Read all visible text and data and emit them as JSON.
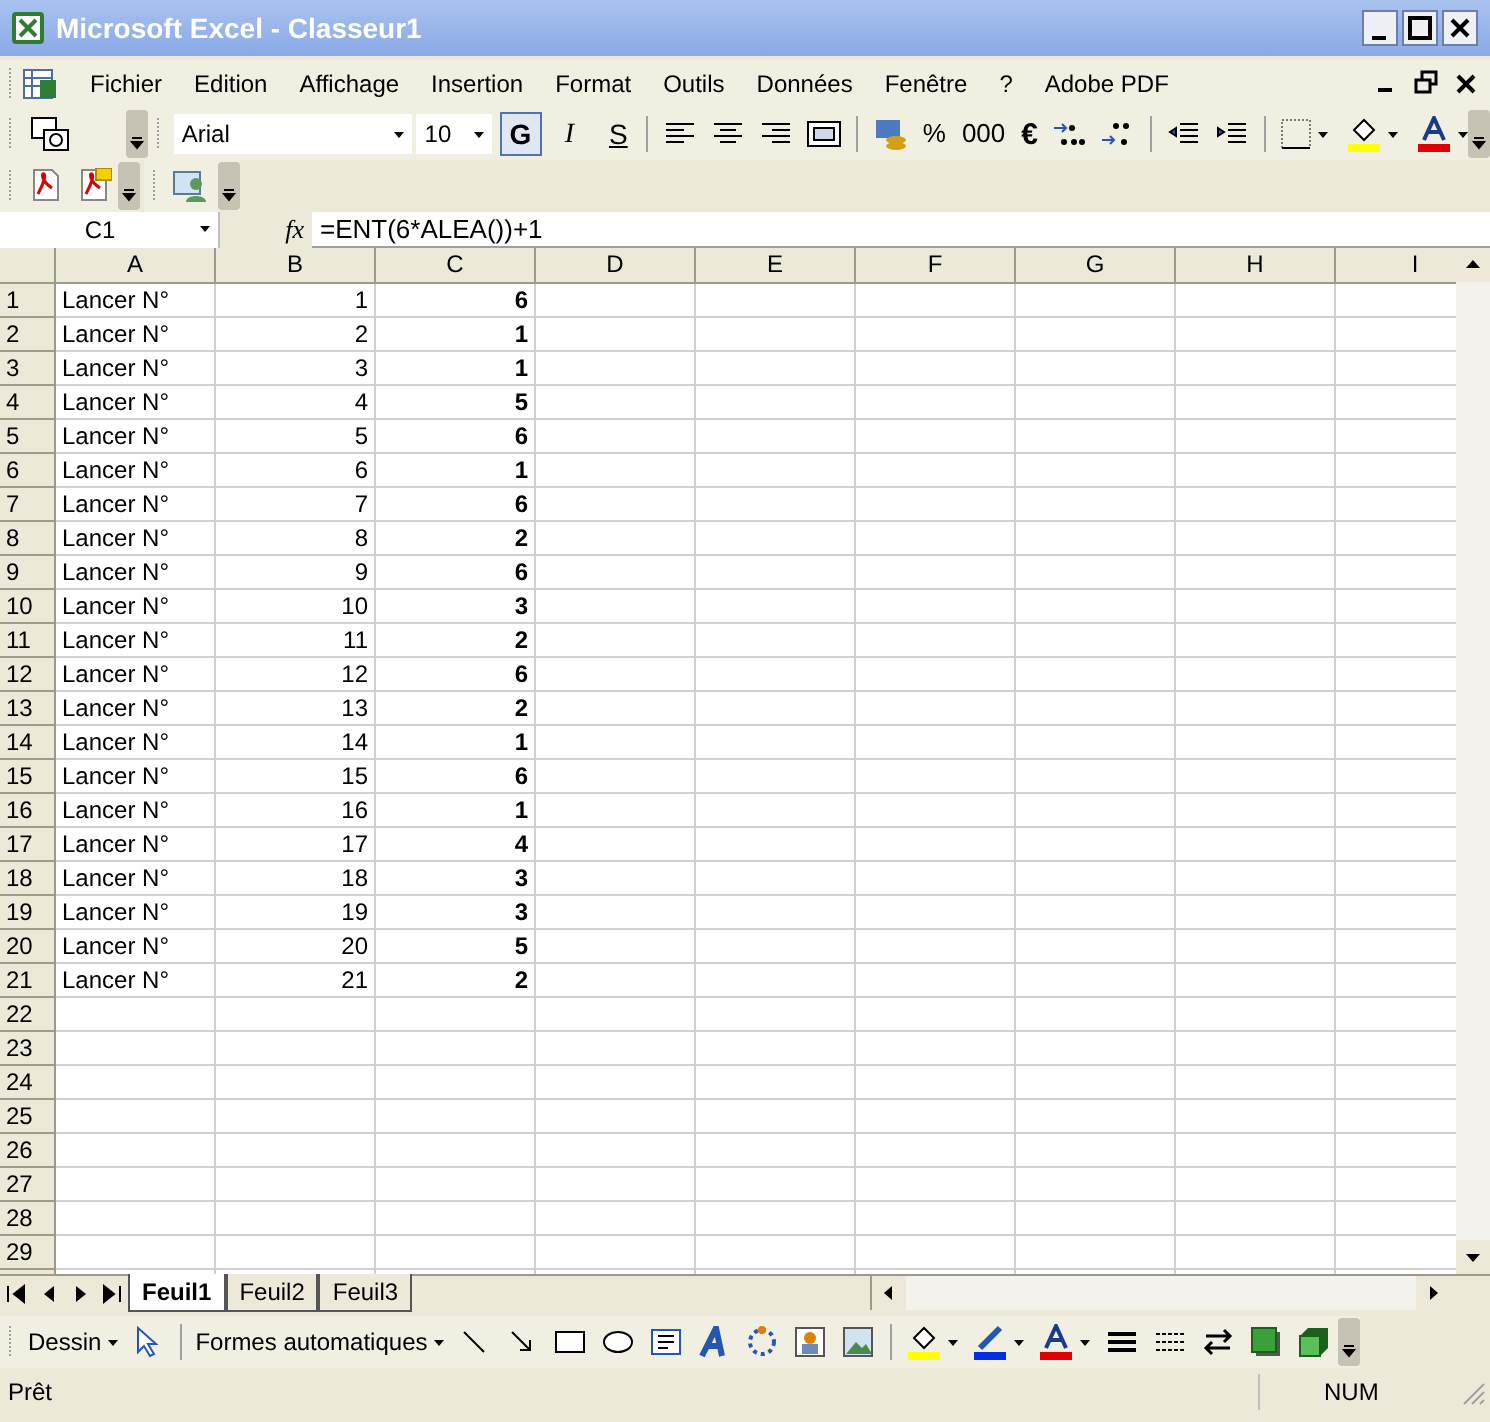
{
  "window": {
    "title": "Microsoft Excel - Classeur1"
  },
  "menu": [
    "Fichier",
    "Edition",
    "Affichage",
    "Insertion",
    "Format",
    "Outils",
    "Données",
    "Fenêtre",
    "?",
    "Adobe PDF"
  ],
  "formatting": {
    "font": "Arial",
    "size": "10",
    "styles": [
      {
        "label": "G",
        "selected": true
      },
      {
        "label": "I",
        "selected": false
      },
      {
        "label": "S",
        "selected": false
      }
    ],
    "number_buttons": [
      "%",
      "000",
      "€"
    ]
  },
  "formula_bar": {
    "name_box": "C1",
    "fx": "fx",
    "formula": "=ENT(6*ALEA())+1"
  },
  "columns": [
    "A",
    "B",
    "C",
    "D",
    "E",
    "F",
    "G",
    "H",
    "I"
  ],
  "rows": [
    {
      "header": "1",
      "cells": [
        "Lancer N°",
        "1",
        "6"
      ]
    },
    {
      "header": "2",
      "cells": [
        "Lancer N°",
        "2",
        "1"
      ]
    },
    {
      "header": "3",
      "cells": [
        "Lancer N°",
        "3",
        "1"
      ]
    },
    {
      "header": "4",
      "cells": [
        "Lancer N°",
        "4",
        "5"
      ]
    },
    {
      "header": "5",
      "cells": [
        "Lancer N°",
        "5",
        "6"
      ]
    },
    {
      "header": "6",
      "cells": [
        "Lancer N°",
        "6",
        "1"
      ]
    },
    {
      "header": "7",
      "cells": [
        "Lancer N°",
        "7",
        "6"
      ]
    },
    {
      "header": "8",
      "cells": [
        "Lancer N°",
        "8",
        "2"
      ]
    },
    {
      "header": "9",
      "cells": [
        "Lancer N°",
        "9",
        "6"
      ]
    },
    {
      "header": "10",
      "cells": [
        "Lancer N°",
        "10",
        "3"
      ]
    },
    {
      "header": "11",
      "cells": [
        "Lancer N°",
        "11",
        "2"
      ]
    },
    {
      "header": "12",
      "cells": [
        "Lancer N°",
        "12",
        "6"
      ]
    },
    {
      "header": "13",
      "cells": [
        "Lancer N°",
        "13",
        "2"
      ]
    },
    {
      "header": "14",
      "cells": [
        "Lancer N°",
        "14",
        "1"
      ]
    },
    {
      "header": "15",
      "cells": [
        "Lancer N°",
        "15",
        "6"
      ]
    },
    {
      "header": "16",
      "cells": [
        "Lancer N°",
        "16",
        "1"
      ]
    },
    {
      "header": "17",
      "cells": [
        "Lancer N°",
        "17",
        "4"
      ]
    },
    {
      "header": "18",
      "cells": [
        "Lancer N°",
        "18",
        "3"
      ]
    },
    {
      "header": "19",
      "cells": [
        "Lancer N°",
        "19",
        "3"
      ]
    },
    {
      "header": "20",
      "cells": [
        "Lancer N°",
        "20",
        "5"
      ]
    },
    {
      "header": "21",
      "cells": [
        "Lancer N°",
        "21",
        "2"
      ]
    },
    {
      "header": "22",
      "cells": []
    },
    {
      "header": "23",
      "cells": []
    },
    {
      "header": "24",
      "cells": []
    },
    {
      "header": "25",
      "cells": []
    },
    {
      "header": "26",
      "cells": []
    },
    {
      "header": "27",
      "cells": []
    },
    {
      "header": "28",
      "cells": []
    },
    {
      "header": "29",
      "cells": []
    }
  ],
  "sheets": [
    {
      "label": "Feuil1",
      "selected": true
    },
    {
      "label": "Feuil2",
      "selected": false
    },
    {
      "label": "Feuil3",
      "selected": false
    }
  ],
  "drawing_toolbar": {
    "draw_menu": "Dessin",
    "autoshapes": "Formes automatiques"
  },
  "status_bar": {
    "message": "Prêt",
    "num": "NUM"
  }
}
